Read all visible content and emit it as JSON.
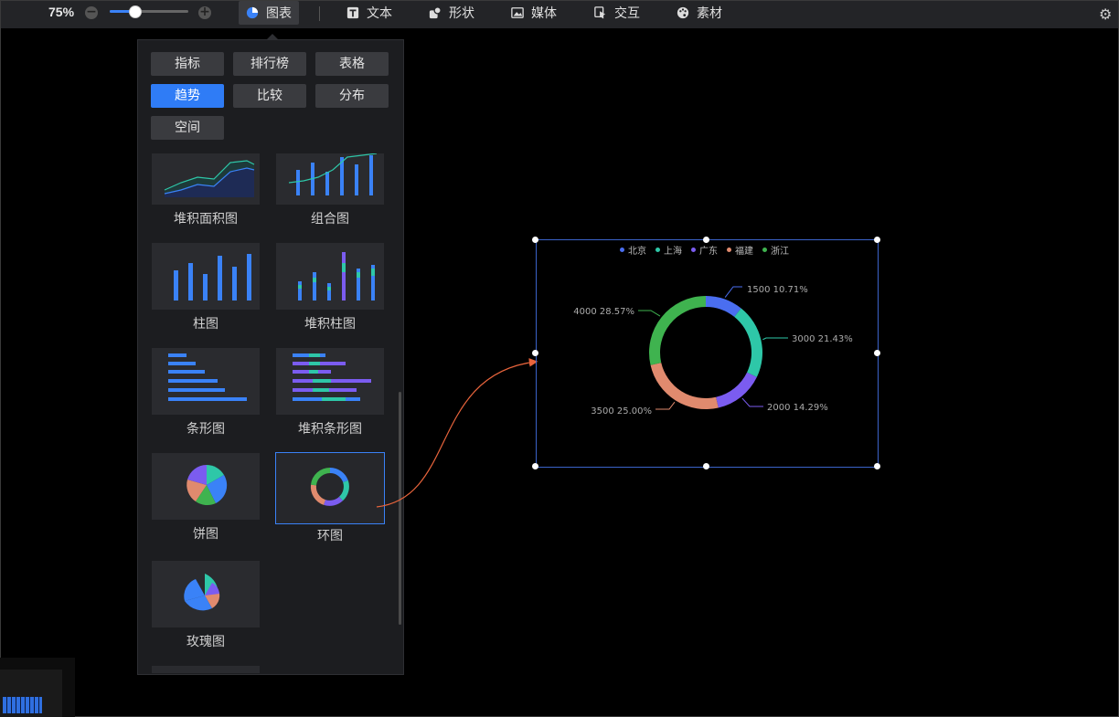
{
  "toolbar": {
    "zoom": "75%",
    "zoom_out_icon": "minus-circle-icon",
    "zoom_in_icon": "plus-circle-icon",
    "tools": [
      {
        "label": "图表",
        "icon": "pie-chart-icon",
        "active": true
      },
      {
        "label": "文本",
        "icon": "text-icon"
      },
      {
        "label": "形状",
        "icon": "shape-icon"
      },
      {
        "label": "媒体",
        "icon": "image-icon"
      },
      {
        "label": "交互",
        "icon": "interaction-icon"
      },
      {
        "label": "素材",
        "icon": "palette-icon"
      }
    ],
    "settings_icon": "gear-icon"
  },
  "panel": {
    "categories": [
      {
        "label": "指标"
      },
      {
        "label": "排行榜"
      },
      {
        "label": "表格"
      },
      {
        "label": "趋势",
        "selected": true
      },
      {
        "label": "比较"
      },
      {
        "label": "分布"
      },
      {
        "label": "空间"
      }
    ],
    "charts": [
      {
        "label": "堆积面积图"
      },
      {
        "label": "组合图"
      },
      {
        "label": "柱图"
      },
      {
        "label": "堆积柱图"
      },
      {
        "label": "条形图"
      },
      {
        "label": "堆积条形图"
      },
      {
        "label": "饼图"
      },
      {
        "label": "环图",
        "selected": true
      },
      {
        "label": "玫瑰图"
      }
    ]
  },
  "colors": {
    "accent": "#2f7cf6",
    "beijing": "#4a6ef0",
    "shanghai": "#2ec7a8",
    "guangdong": "#7b5cf0",
    "fujian": "#e08a6e",
    "zhejiang": "#3fb34f",
    "arrow": "#e8643c"
  },
  "chart_data": {
    "type": "pie",
    "variant": "donut",
    "legend_position": "top",
    "series": [
      {
        "name": "北京",
        "value": 1500,
        "percent": "10.71%",
        "label": "1500 10.71%"
      },
      {
        "name": "上海",
        "value": 3000,
        "percent": "21.43%",
        "label": "3000 21.43%"
      },
      {
        "name": "广东",
        "value": 2000,
        "percent": "14.29%",
        "label": "2000 14.29%"
      },
      {
        "name": "福建",
        "value": 3500,
        "percent": "25.00%",
        "label": "3500 25.00%"
      },
      {
        "name": "浙江",
        "value": 4000,
        "percent": "28.57%",
        "label": "4000 28.57%"
      }
    ]
  }
}
